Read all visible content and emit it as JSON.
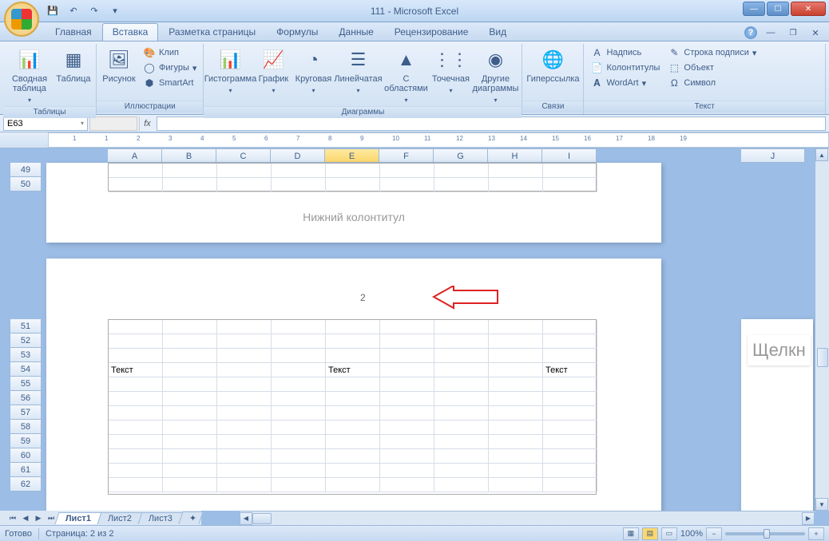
{
  "title": "111 - Microsoft Excel",
  "tabs": [
    "Главная",
    "Вставка",
    "Разметка страницы",
    "Формулы",
    "Данные",
    "Рецензирование",
    "Вид"
  ],
  "active_tab": "Вставка",
  "ribbon": {
    "tables": {
      "label": "Таблицы",
      "pivot": "Сводная таблица",
      "table": "Таблица"
    },
    "illus": {
      "label": "Иллюстрации",
      "picture": "Рисунок",
      "clip": "Клип",
      "shapes": "Фигуры",
      "smartart": "SmartArt"
    },
    "charts": {
      "label": "Диаграммы",
      "column": "Гистограмма",
      "line": "График",
      "pie": "Круговая",
      "bar": "Линейчатая",
      "area": "С областями",
      "scatter": "Точечная",
      "other": "Другие диаграммы"
    },
    "links": {
      "label": "Связи",
      "hyperlink": "Гиперссылка"
    },
    "text": {
      "label": "Текст",
      "textbox": "Надпись",
      "headerfooter": "Колонтитулы",
      "wordart": "WordArt",
      "signature": "Строка подписи",
      "object": "Объект",
      "symbol": "Символ"
    }
  },
  "namebox": "E63",
  "columns": [
    "A",
    "B",
    "C",
    "D",
    "E",
    "F",
    "G",
    "H",
    "I",
    "J"
  ],
  "rows_top": [
    "49",
    "50"
  ],
  "rows_bottom": [
    "51",
    "52",
    "53",
    "54",
    "55",
    "56",
    "57",
    "58",
    "59",
    "60",
    "61",
    "62"
  ],
  "footer_text": "Нижний колонтитул",
  "page_number": "2",
  "cell_texts": {
    "a54": "Текст",
    "e54": "Текст",
    "i54": "Текст"
  },
  "side_text": "Щелкн",
  "sheet_tabs": [
    "Лист1",
    "Лист2",
    "Лист3"
  ],
  "status": {
    "ready": "Готово",
    "page": "Страница: 2 из 2",
    "zoom": "100%"
  }
}
